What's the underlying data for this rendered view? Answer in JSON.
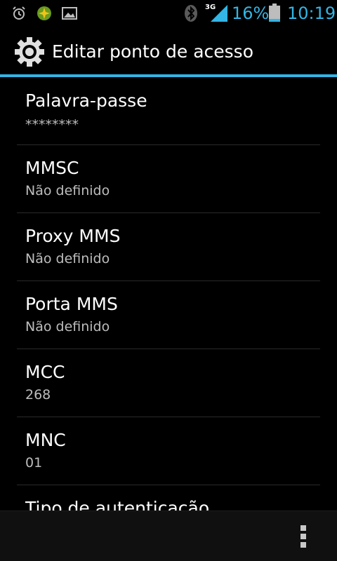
{
  "status_bar": {
    "icons": [
      "alarm-icon",
      "app-notification-icon",
      "image-icon",
      "bluetooth-icon",
      "3g-signal-icon",
      "battery-icon"
    ],
    "network_label": "3G",
    "battery_percent": "16%",
    "time": "10:19",
    "accent_color": "#33b5e5"
  },
  "action_bar": {
    "icon": "settings-icon",
    "title": "Editar ponto de acesso"
  },
  "preferences": [
    {
      "title": "Palavra-passe",
      "summary": "********"
    },
    {
      "title": "MMSC",
      "summary": "Não definido"
    },
    {
      "title": "Proxy MMS",
      "summary": "Não definido"
    },
    {
      "title": "Porta MMS",
      "summary": "Não definido"
    },
    {
      "title": "MCC",
      "summary": "268"
    },
    {
      "title": "MNC",
      "summary": "01"
    },
    {
      "title": "Tipo de autenticação",
      "summary": ""
    }
  ],
  "bottom_bar": {
    "icon": "overflow-menu-icon"
  }
}
